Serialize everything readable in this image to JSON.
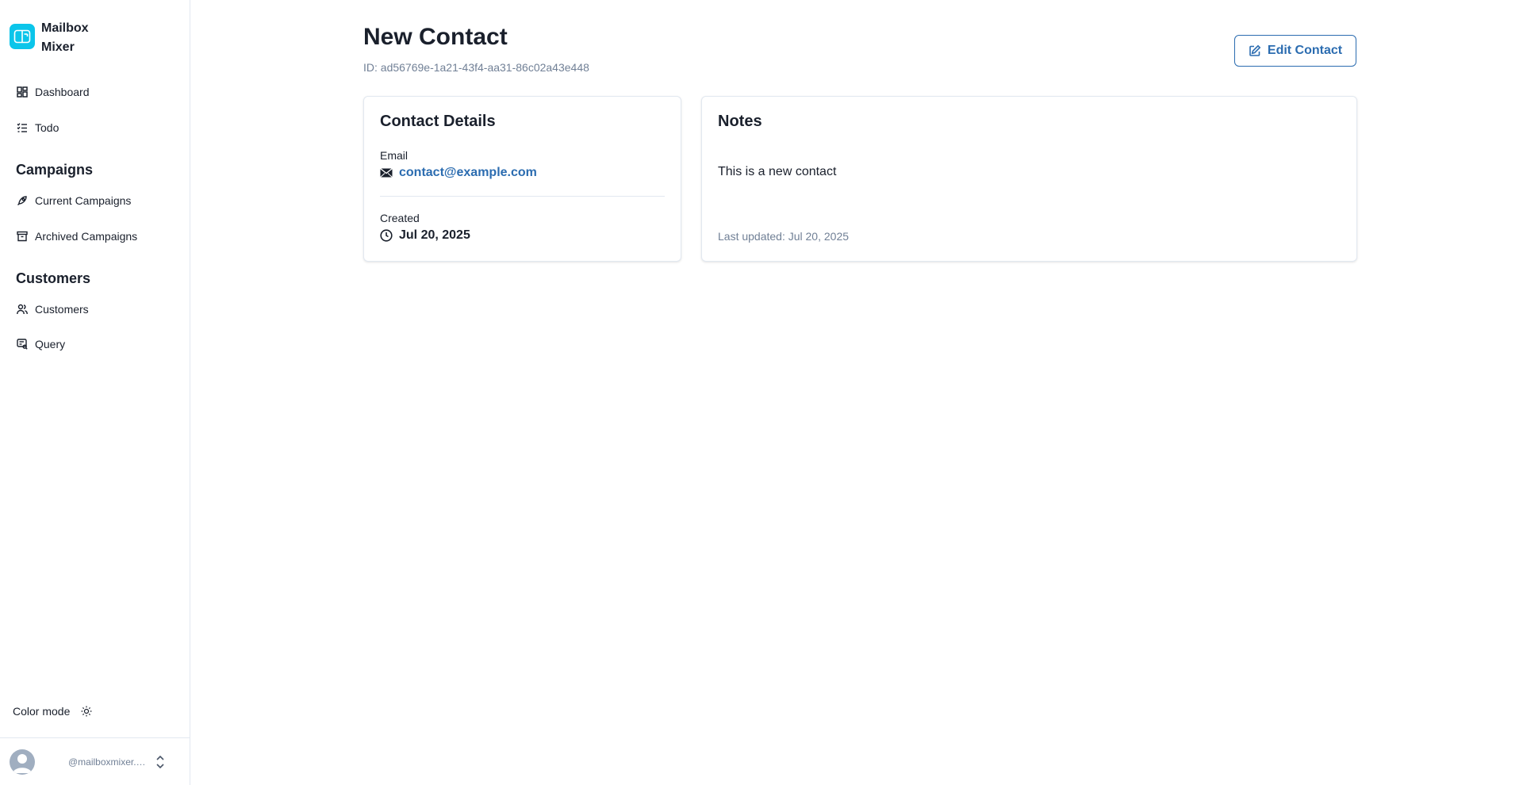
{
  "brand": {
    "name": "Mailbox Mixer",
    "logo_color": "#0BC5EA"
  },
  "sidebar": {
    "top_items": [
      {
        "label": "Dashboard",
        "icon": "dashboard-icon"
      },
      {
        "label": "Todo",
        "icon": "list-check-icon"
      }
    ],
    "sections": [
      {
        "title": "Campaigns",
        "items": [
          {
            "label": "Current Campaigns",
            "icon": "rocket-icon"
          },
          {
            "label": "Archived Campaigns",
            "icon": "archive-icon"
          }
        ]
      },
      {
        "title": "Customers",
        "items": [
          {
            "label": "Customers",
            "icon": "users-icon"
          },
          {
            "label": "Query",
            "icon": "query-icon"
          }
        ]
      }
    ],
    "color_mode_label": "Color mode",
    "user_email": "@mailboxmixer.com"
  },
  "page": {
    "title": "New Contact",
    "id_text": "ID: ad56769e-1a21-43f4-aa31-86c02a43e448",
    "edit_button_label": "Edit Contact"
  },
  "details_card": {
    "title": "Contact Details",
    "email_label": "Email",
    "email_value": "contact@example.com",
    "created_label": "Created",
    "created_value": "Jul 20, 2025"
  },
  "notes_card": {
    "title": "Notes",
    "body": "This is a new contact",
    "last_updated": "Last updated: Jul 20, 2025"
  },
  "colors": {
    "accent": "#2B6CB0",
    "text": "#1A202C",
    "muted": "#718096",
    "border": "#E2E8F0"
  }
}
